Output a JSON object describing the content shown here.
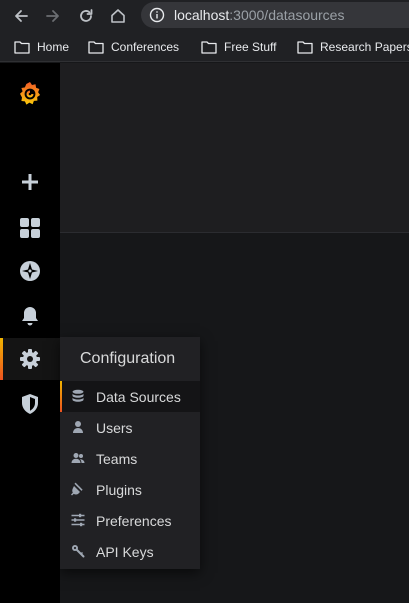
{
  "browser": {
    "url_host": "localhost",
    "url_path": ":3000/datasources"
  },
  "bookmarks": [
    {
      "label": "Home",
      "icon": "folder-icon"
    },
    {
      "label": "Conferences",
      "icon": "folder-icon"
    },
    {
      "label": "Free Stuff",
      "icon": "folder-icon"
    },
    {
      "label": "Research Papers",
      "icon": "folder-icon"
    }
  ],
  "sidemenu": {
    "items": [
      {
        "name": "grafana-logo",
        "icon": "grafana-logo-icon"
      },
      {
        "name": "create",
        "icon": "plus-icon"
      },
      {
        "name": "dashboards",
        "icon": "apps-icon"
      },
      {
        "name": "explore",
        "icon": "compass-icon"
      },
      {
        "name": "alerting",
        "icon": "bell-icon"
      },
      {
        "name": "configuration",
        "icon": "gear-icon",
        "active": true
      },
      {
        "name": "server-admin",
        "icon": "shield-icon"
      }
    ]
  },
  "config_menu": {
    "title": "Configuration",
    "items": [
      {
        "label": "Data Sources",
        "icon": "database-icon",
        "active": true
      },
      {
        "label": "Users",
        "icon": "user-icon"
      },
      {
        "label": "Teams",
        "icon": "users-icon"
      },
      {
        "label": "Plugins",
        "icon": "plug-icon"
      },
      {
        "label": "Preferences",
        "icon": "sliders-icon"
      },
      {
        "label": "API Keys",
        "icon": "key-icon"
      }
    ]
  },
  "colors": {
    "accent_top": "#f0b400",
    "accent_bottom": "#ee5320",
    "sidemenu_bg": "#000000",
    "page_bg": "#161719"
  }
}
